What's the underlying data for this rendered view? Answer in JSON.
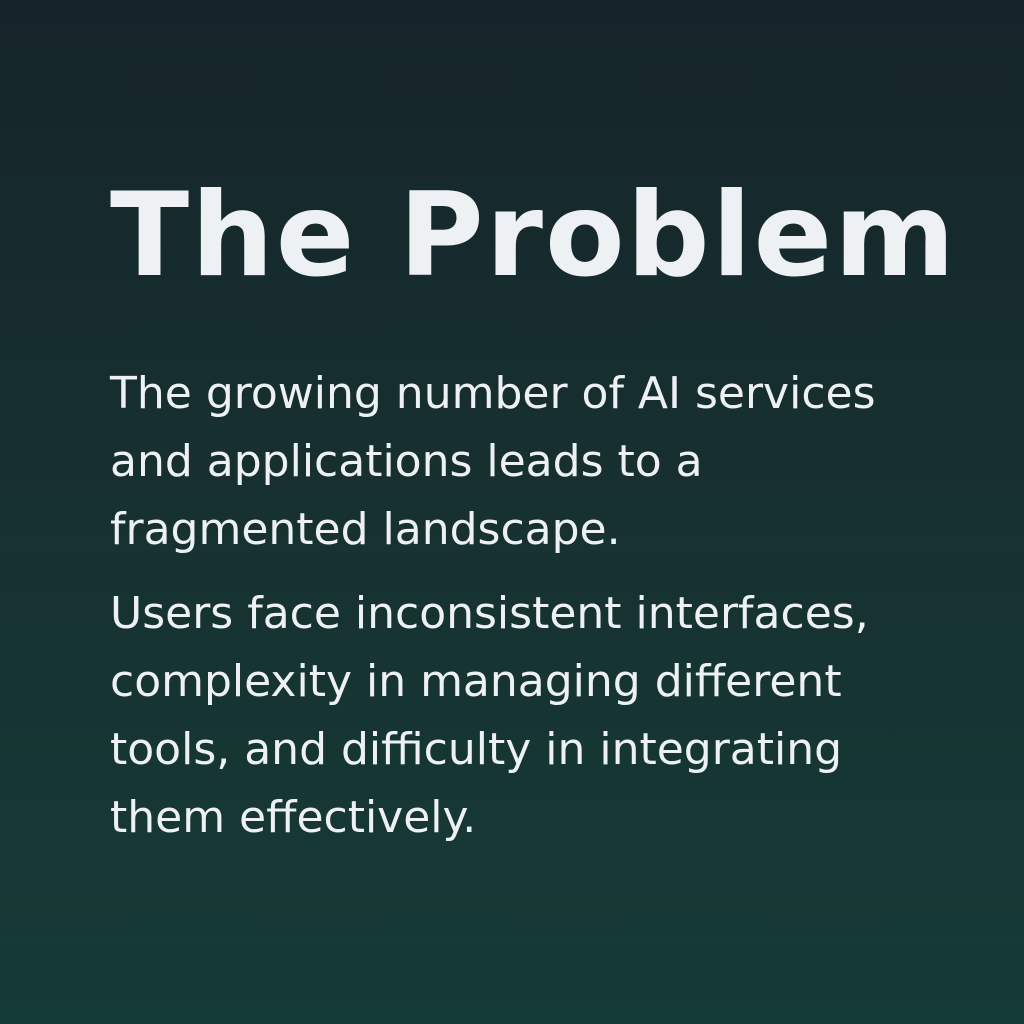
{
  "slide": {
    "title": "The Problem",
    "paragraphs": [
      "The growing number of AI services\nand applications leads to a\nfragmented landscape.",
      "Users face inconsistent interfaces,\ncomplexity in managing different\ntools, and difficulty in integrating\nthem effectively."
    ]
  },
  "colors": {
    "background_top": "#15242a",
    "background_bottom": "#153b36",
    "text": "#eef1f4"
  }
}
